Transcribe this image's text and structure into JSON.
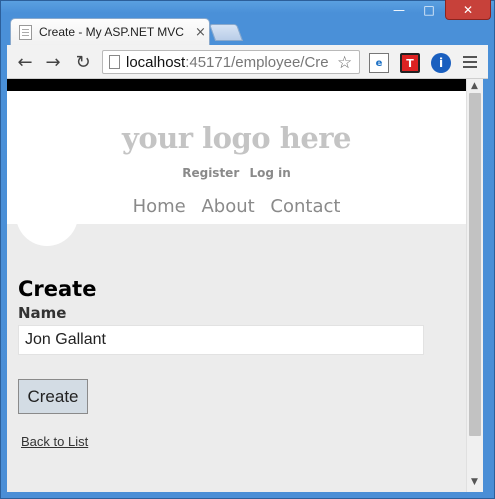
{
  "window": {
    "tab_title": "Create - My ASP.NET MVC",
    "tab_close": "×",
    "controls": {
      "minimize": "—",
      "maximize": "□",
      "close": "✕"
    }
  },
  "toolbar": {
    "back": "←",
    "forward": "→",
    "reload": "↻",
    "url_host": "localhost",
    "url_path": ":45171/employee/Cre",
    "star": "☆",
    "ext_ie": "e",
    "ext_t": "T",
    "ext_info": "i"
  },
  "header": {
    "logo": "your logo here",
    "register": "Register",
    "login": "Log in",
    "nav": [
      "Home",
      "About",
      "Contact"
    ]
  },
  "form": {
    "title": "Create",
    "name_label": "Name",
    "name_value": "Jon Gallant",
    "submit": "Create",
    "back_link": "Back to List"
  },
  "scrollbar": {
    "up": "▲",
    "down": "▼"
  }
}
